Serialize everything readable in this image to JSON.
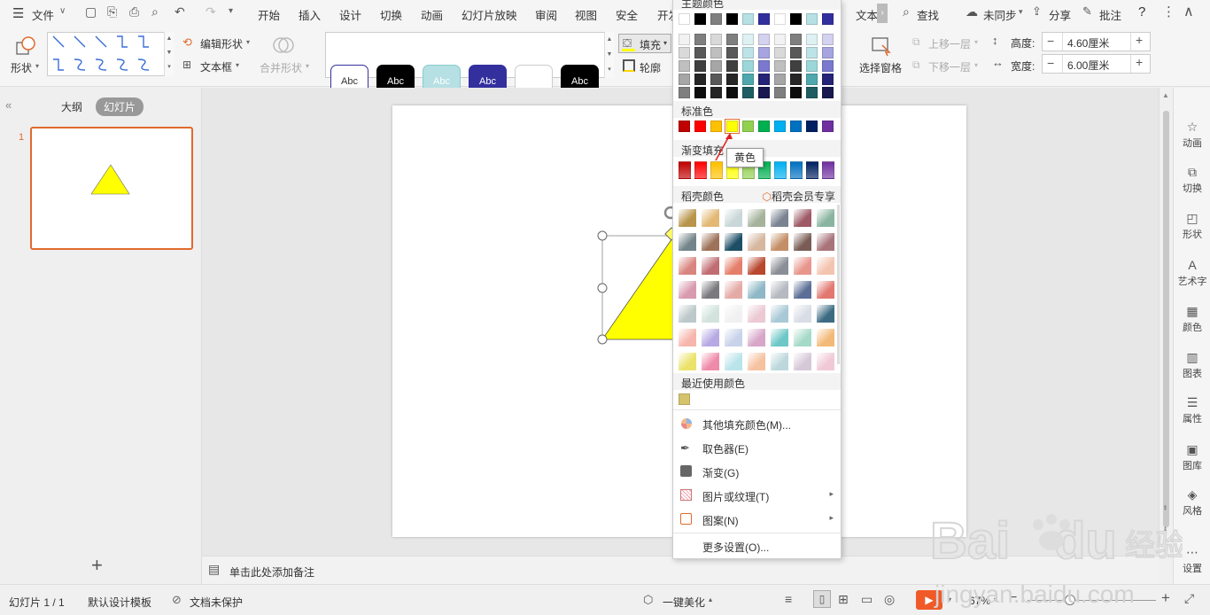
{
  "menubar": {
    "file_label": "文件",
    "tabs": [
      "开始",
      "插入",
      "设计",
      "切换",
      "动画",
      "幻灯片放映",
      "审阅",
      "视图",
      "安全",
      "开发",
      "文本"
    ],
    "search_label": "查找",
    "sync_label": "未同步",
    "share_label": "分享",
    "comment_label": "批注",
    "help_label": "?"
  },
  "ribbon": {
    "shape_label": "形状",
    "edit_shape_label": "编辑形状",
    "textbox_label": "文本框",
    "merge_shape_label": "合并形状",
    "style_boxes": [
      "Abc",
      "Abc",
      "Abc",
      "Abc",
      "",
      "Abc"
    ],
    "fill_label": "填充",
    "outline_label": "轮廓",
    "selection_pane_label": "选择窗格",
    "bring_forward_label": "上移一层",
    "send_backward_label": "下移一层",
    "height_label": "高度:",
    "height_value": "4.60厘米",
    "width_label": "宽度:",
    "width_value": "6.00厘米",
    "colors": {
      "accent": "#e06a2c",
      "purple": "#33309e",
      "lightblue": "#b6e0e3"
    }
  },
  "left_panel": {
    "outline_tab": "大纲",
    "slides_tab": "幻灯片",
    "slide_number": "1",
    "add_label": "+"
  },
  "slide": {
    "triangle_color": "#ffff00"
  },
  "notes": {
    "placeholder": "单击此处添加备注"
  },
  "right_bar": {
    "items": [
      "动画",
      "切换",
      "形状",
      "艺术字",
      "颜色",
      "图表",
      "属性",
      "图库",
      "风格"
    ],
    "settings_label": "设置"
  },
  "status": {
    "slide_info": "幻灯片 1 / 1",
    "template": "默认设计模板",
    "protect": "文档未保护",
    "beautify": "一键美化",
    "zoom": "67%"
  },
  "dropdown": {
    "theme_colors_label": "主题颜色",
    "standard_colors_label": "标准色",
    "gradient_fill_label": "渐变填充",
    "daoke_colors_label": "稻壳颜色",
    "vip_label": "稻壳会员专享",
    "recent_colors_label": "最近使用颜色",
    "theme_top_colors": [
      "#ffffff",
      "#000000",
      "#808080",
      "#000000",
      "#b6e0e3",
      "#33309e",
      "#ffffff",
      "#000000",
      "#b6e0e3",
      "#33309e"
    ],
    "standard_colors": [
      "#c00000",
      "#ff0000",
      "#ffc000",
      "#ffff00",
      "#92d050",
      "#00b050",
      "#00b0f0",
      "#0070c0",
      "#002060",
      "#7030a0"
    ],
    "gradient_colors": [
      "#c00000",
      "#ff0000",
      "#ffc000",
      "#ffff00",
      "#92d050",
      "#00b050",
      "#00b0f0",
      "#0070c0",
      "#002060",
      "#7030a0"
    ],
    "recent_colors": [
      "#d6c36e"
    ],
    "items": {
      "more_fill_colors": "其他填充颜色(M)...",
      "eyedropper": "取色器(E)",
      "gradient": "渐变(G)",
      "picture_texture": "图片或纹理(T)",
      "pattern": "图案(N)",
      "more_settings": "更多设置(O)..."
    },
    "tooltip": "黄色"
  }
}
